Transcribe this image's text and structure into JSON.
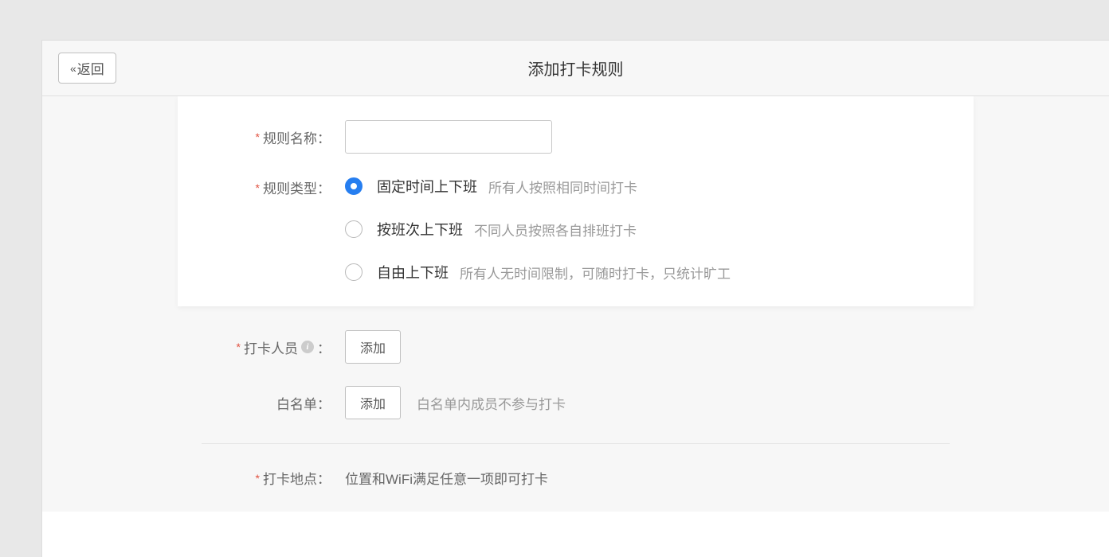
{
  "header": {
    "back_label": "返回",
    "title": "添加打卡规则"
  },
  "form": {
    "rule_name": {
      "label": "规则名称：",
      "value": ""
    },
    "rule_type": {
      "label": "规则类型：",
      "options": [
        {
          "title": "固定时间上下班",
          "desc": "所有人按照相同时间打卡",
          "selected": true
        },
        {
          "title": "按班次上下班",
          "desc": "不同人员按照各自排班打卡",
          "selected": false
        },
        {
          "title": "自由上下班",
          "desc": "所有人无时间限制，可随时打卡，只统计旷工",
          "selected": false
        }
      ]
    },
    "checkin_staff": {
      "label": "打卡人员",
      "colon": "：",
      "button": "添加"
    },
    "whitelist": {
      "label": "白名单：",
      "button": "添加",
      "desc": "白名单内成员不参与打卡"
    },
    "location": {
      "label": "打卡地点：",
      "desc": "位置和WiFi满足任意一项即可打卡"
    }
  }
}
